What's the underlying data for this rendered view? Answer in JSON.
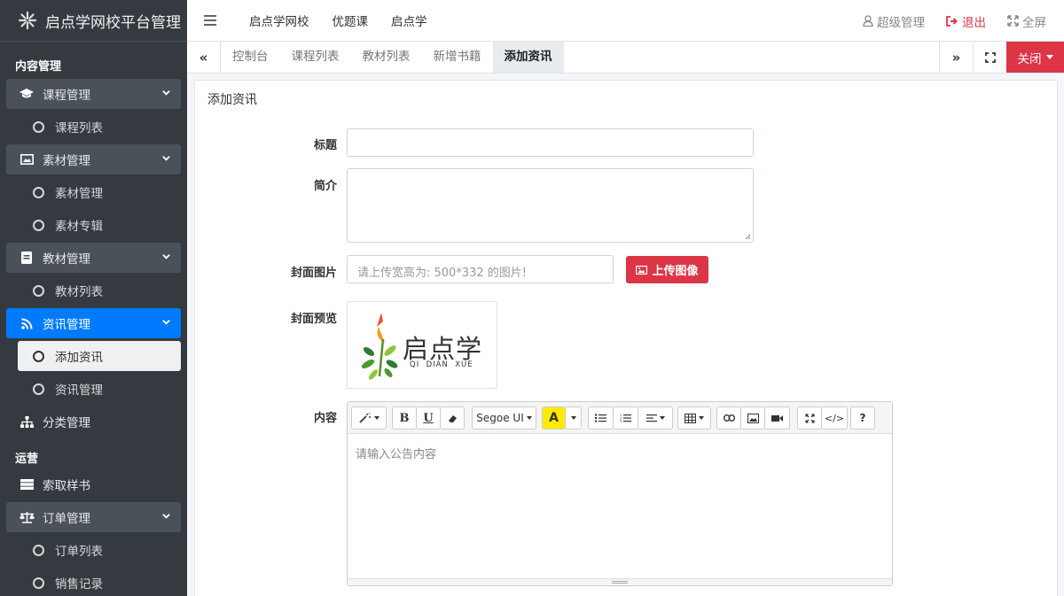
{
  "brand": {
    "title": "启点学网校平台管理"
  },
  "sidebar": {
    "header_content": "内容管理",
    "header_ops": "运营",
    "course": {
      "label": "课程管理",
      "items": [
        "课程列表"
      ]
    },
    "material": {
      "label": "素材管理",
      "items": [
        "素材管理",
        "素材专辑"
      ]
    },
    "textbook": {
      "label": "教材管理",
      "items": [
        "教材列表"
      ]
    },
    "news": {
      "label": "资讯管理",
      "items": [
        "添加资讯",
        "资讯管理"
      ]
    },
    "category": {
      "label": "分类管理"
    },
    "sample": {
      "label": "索取样书"
    },
    "order": {
      "label": "订单管理",
      "items": [
        "订单列表",
        "销售记录"
      ]
    }
  },
  "topbar": {
    "nav": [
      "启点学网校",
      "优题课",
      "启点学"
    ],
    "user": "超级管理",
    "logout": "退出",
    "fullscreen": "全屏"
  },
  "tabs": {
    "items": [
      "控制台",
      "课程列表",
      "教材列表",
      "新增书籍",
      "添加资讯"
    ],
    "active_index": 4,
    "close_label": "关闭"
  },
  "form": {
    "card_title": "添加资讯",
    "title_label": "标题",
    "title_value": "",
    "intro_label": "简介",
    "intro_value": "",
    "cover_label": "封面图片",
    "cover_placeholder": "请上传宽高为: 500*332 的图片!",
    "upload_label": "上传图像",
    "preview_label": "封面预览",
    "preview_logo": {
      "brand": "启点学",
      "sub": "QI  DIAN  XUE"
    },
    "content_label": "内容",
    "content_placeholder": "请输入公告内容",
    "editor": {
      "font_name": "Segoe UI",
      "bold": "B",
      "underline": "U",
      "highlight": "A",
      "help": "?",
      "code": "</>"
    }
  },
  "colors": {
    "sidebar_bg": "#343a40",
    "accent": "#007bff",
    "danger": "#dc3545"
  }
}
